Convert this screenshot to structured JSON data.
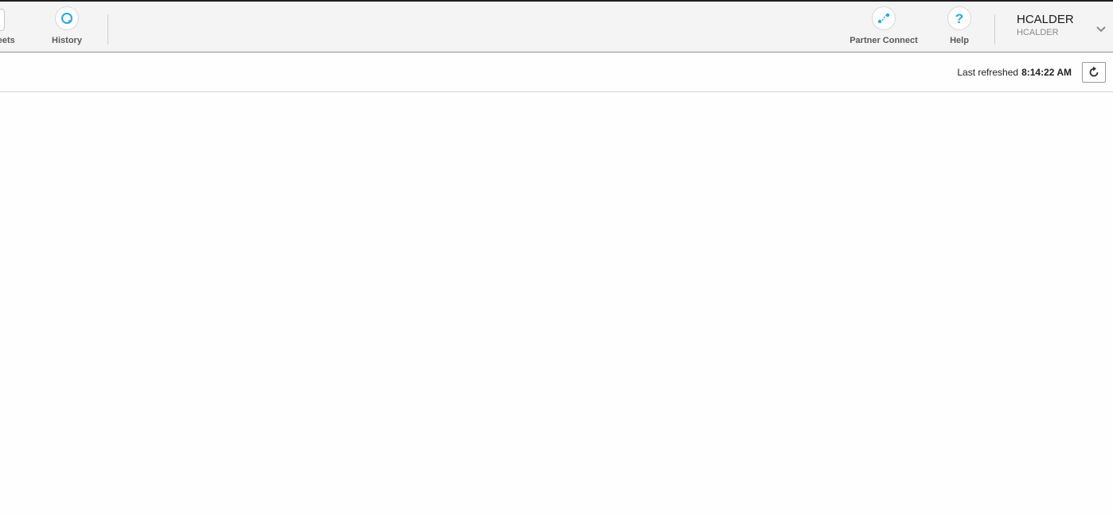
{
  "topbar": {
    "sheets_label": "heets",
    "history_label": "History",
    "partner_connect_label": "Partner Connect",
    "help_label": "Help",
    "user": {
      "name": "HCALDER",
      "role": "HCALDER"
    }
  },
  "toolbar": {
    "last_refreshed_label": "Last refreshed",
    "last_refreshed_time": "8:14:22 AM"
  },
  "icons": {
    "history": "history-icon",
    "partner_connect": "partner-connect-icon",
    "help": "help-icon",
    "user_menu": "chevron-down-icon",
    "refresh": "refresh-icon"
  },
  "colors": {
    "accent": "#29a8e0",
    "topbar_bg": "#f4f4f4"
  }
}
